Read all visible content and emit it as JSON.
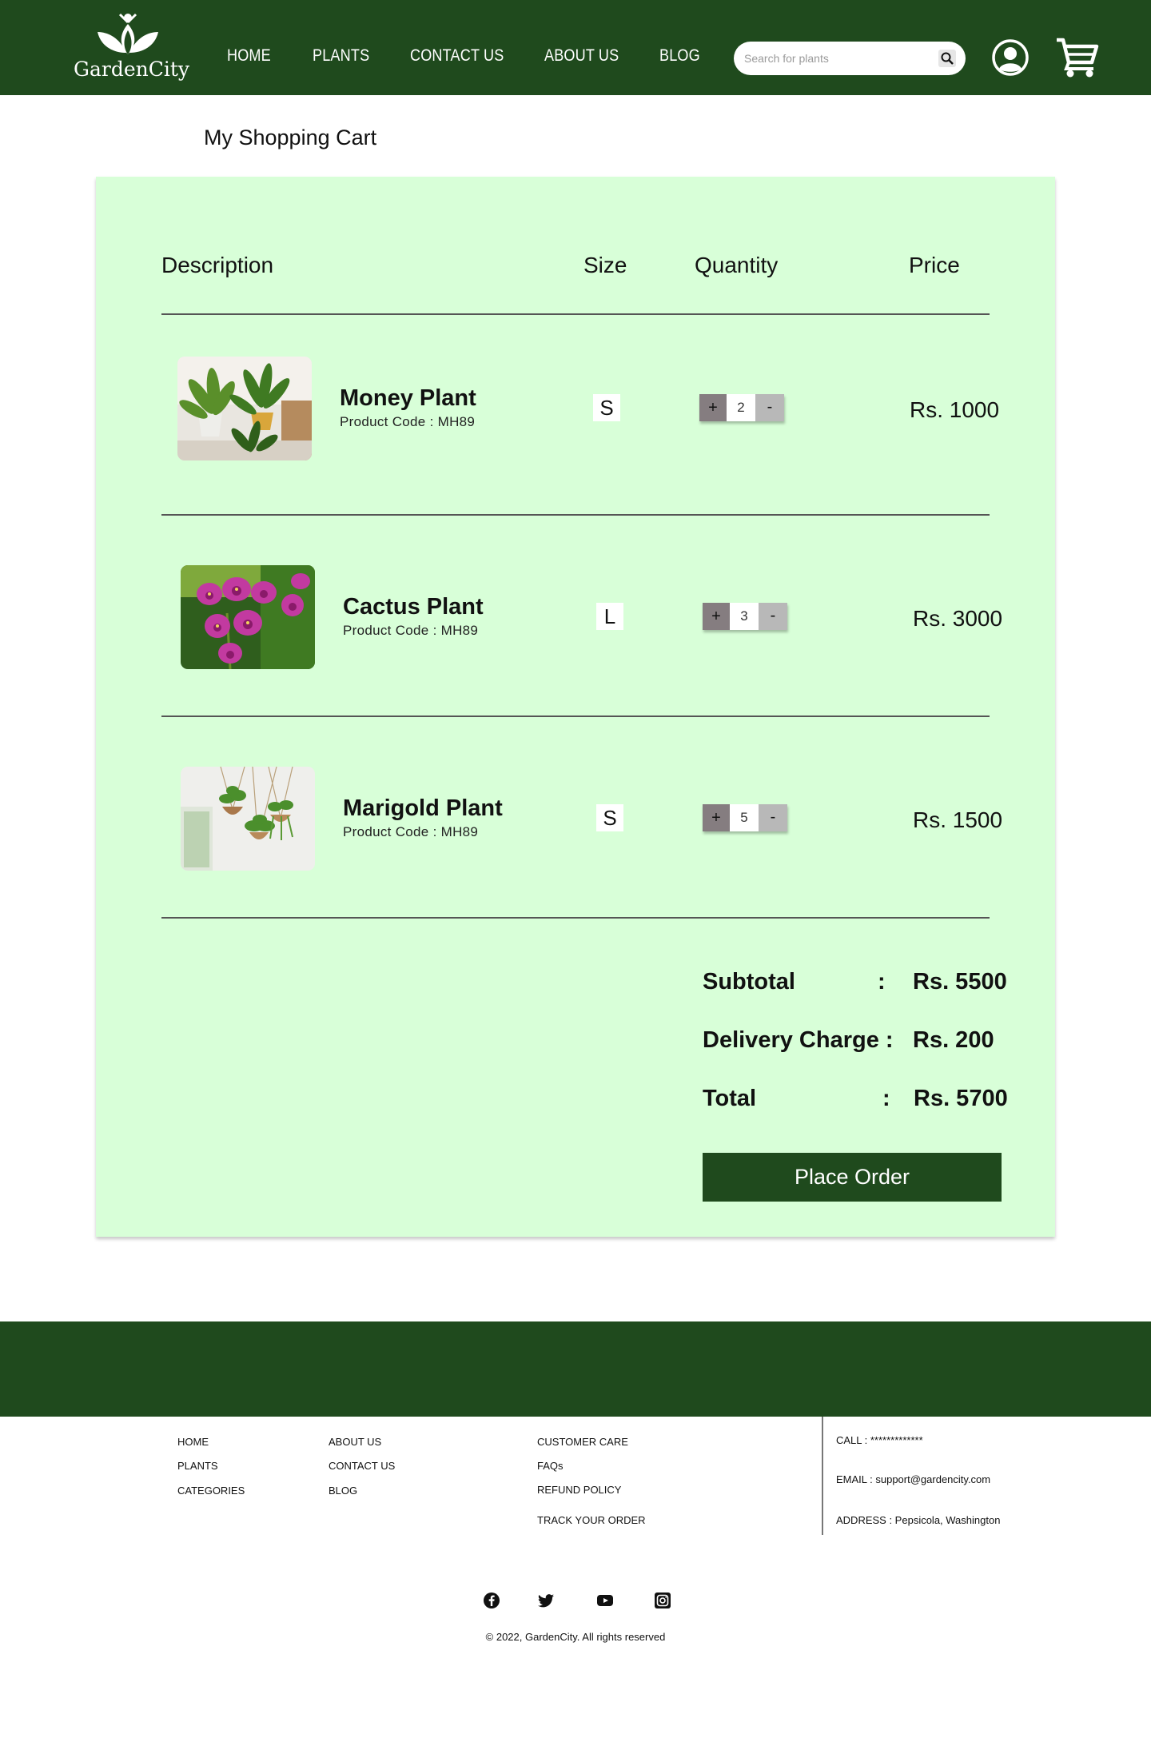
{
  "brand": {
    "name": "GardenCity",
    "color": "#1f4a1d",
    "panel_color": "#d8ffd8"
  },
  "nav": {
    "items": [
      "HOME",
      "PLANTS",
      "CONTACT US",
      "ABOUT US",
      "BLOG"
    ]
  },
  "search": {
    "placeholder": "Search for plants",
    "icon": "search-icon"
  },
  "header_icons": [
    "user-icon",
    "cart-icon"
  ],
  "page": {
    "title": "My Shopping Cart"
  },
  "cart": {
    "columns": {
      "description": "Description",
      "size": "Size",
      "quantity": "Quantity",
      "price": "Price"
    },
    "items": [
      {
        "name": "Money Plant",
        "code": "Product Code : MH89",
        "size": "S",
        "plus": "+",
        "qty": "2",
        "minus": "-",
        "price": "Rs. 1000"
      },
      {
        "name": "Cactus Plant",
        "code": "Product Code : MH89",
        "size": "L",
        "plus": "+",
        "qty": "3",
        "minus": "-",
        "price": "Rs. 3000"
      },
      {
        "name": "Marigold Plant",
        "code": "Product Code : MH89",
        "size": "S",
        "plus": "+",
        "qty": "5",
        "minus": "-",
        "price": "Rs. 1500"
      }
    ],
    "summary": {
      "subtotal_label": "Subtotal",
      "subtotal_colon": ":",
      "subtotal_value": "Rs. 5500",
      "delivery_label": "Delivery Charge :",
      "delivery_value": "Rs. 200",
      "total_label": "Total",
      "total_colon": ":",
      "total_value": "Rs. 5700"
    },
    "place_order": "Place Order"
  },
  "footer": {
    "col1": [
      "HOME",
      "PLANTS",
      "CATEGORIES"
    ],
    "col2": [
      "ABOUT US",
      "CONTACT US",
      "BLOG"
    ],
    "col3": [
      "CUSTOMER CARE",
      "FAQs",
      "REFUND POLICY",
      "TRACK YOUR ORDER"
    ],
    "contact": {
      "call": "CALL : *************",
      "email": "EMAIL : support@gardencity.com",
      "address": "ADDRESS : Pepsicola, Washington"
    },
    "social": [
      "facebook-icon",
      "twitter-icon",
      "youtube-icon",
      "instagram-icon"
    ],
    "copyright": "© 2022, GardenCity. All rights reserved"
  }
}
